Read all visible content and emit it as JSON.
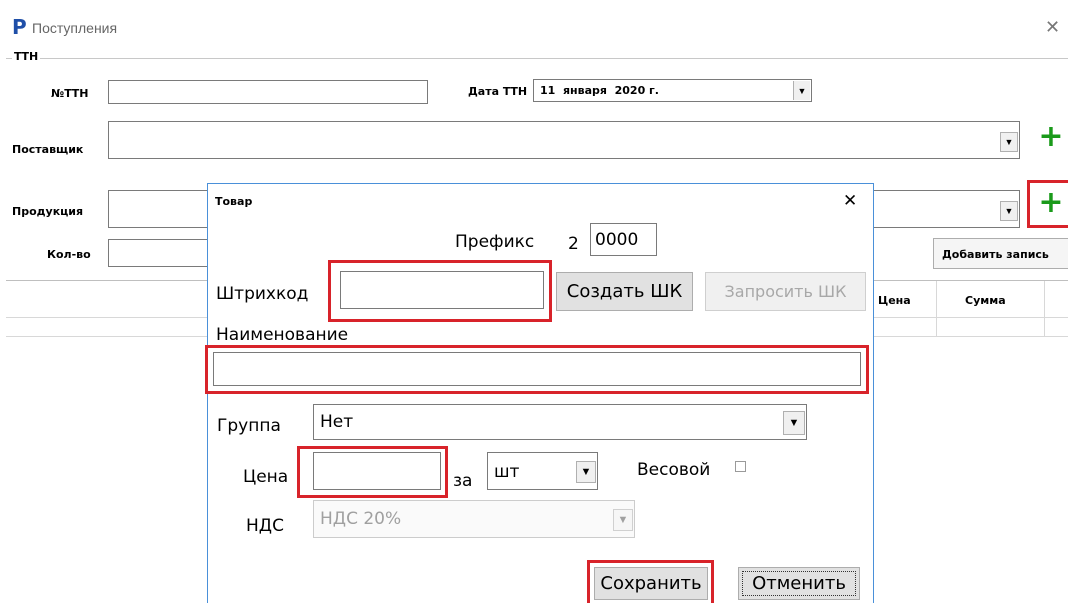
{
  "window": {
    "title": "Поступления",
    "close_glyph": "✕",
    "logo_glyph": "P",
    "brand_color": "#1f4fa8"
  },
  "ttn_group": {
    "label": "ТТН"
  },
  "form": {
    "ttn_number_label": "№ТТН",
    "ttn_number_value": "",
    "ttn_date_label": "Дата ТТН",
    "ttn_date_value": "11  января  2020 г.",
    "supplier_label": "Поставщик",
    "supplier_value": "",
    "product_label": "Продукция",
    "product_value": "",
    "qty_label": "Кол-во",
    "qty_value": "",
    "add_record_label": "Добавить запись"
  },
  "table": {
    "columns": [
      "Цена",
      "Сумма"
    ]
  },
  "dialog": {
    "title": "Товар",
    "close_glyph": "✕",
    "prefix_label": "Префикс",
    "prefix_digit": "2",
    "prefix_value": "0000",
    "barcode_label": "Штрихкод",
    "barcode_value": "",
    "create_barcode_label": "Создать ШК",
    "request_barcode_label": "Запросить ШК",
    "name_label": "Наименование",
    "name_value": "",
    "group_label": "Группа",
    "group_value": "Нет",
    "price_label": "Цена",
    "price_value": "",
    "per_label": "за",
    "unit_value": "шт",
    "weight_label": "Весовой",
    "vat_label": "НДС",
    "vat_value": "НДС 20%",
    "save_label": "Сохранить",
    "cancel_label": "Отменить"
  },
  "colors": {
    "highlight": "#d8232a",
    "plus": "#1a9a1a",
    "dialog_border": "#4a90d9"
  }
}
